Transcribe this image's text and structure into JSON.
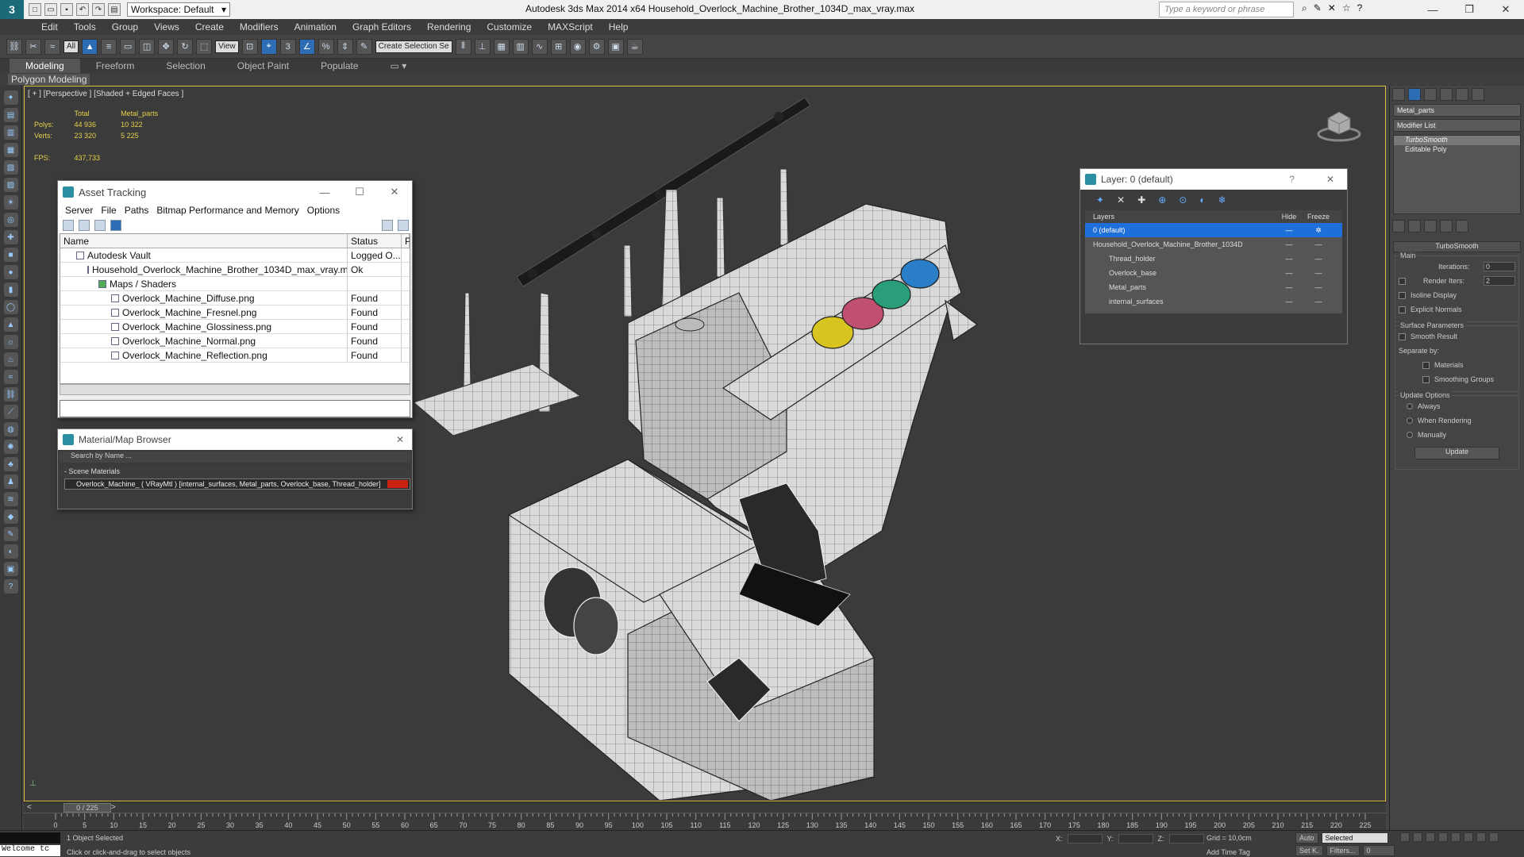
{
  "app": {
    "logo": "3",
    "title": "Autodesk 3ds Max  2014 x64     Household_Overlock_Machine_Brother_1034D_max_vray.max",
    "workspace": "Workspace: Default",
    "search_placeholder": "Type a keyword or phrase"
  },
  "menu": [
    "Edit",
    "Tools",
    "Group",
    "Views",
    "Create",
    "Modifiers",
    "Animation",
    "Graph Editors",
    "Rendering",
    "Customize",
    "MAXScript",
    "Help"
  ],
  "toolbar": {
    "filter": "All",
    "refcoord": "View",
    "selset": "Create Selection Se"
  },
  "ribbon": {
    "tabs": [
      "Modeling",
      "Freeform",
      "Selection",
      "Object Paint",
      "Populate"
    ],
    "active_tab": "Modeling",
    "sub": "Polygon Modeling"
  },
  "viewport": {
    "label": "[ + ] [Perspective ] [Shaded + Edged Faces ]",
    "stats": {
      "h_total": "Total",
      "h_obj": "Metal_parts",
      "polys_label": "Polys:",
      "polys_total": "44 936",
      "polys_obj": "10 322",
      "verts_label": "Verts:",
      "verts_total": "23 320",
      "verts_obj": "5 225",
      "fps_label": "FPS:",
      "fps": "437,733"
    }
  },
  "asset_tracking": {
    "title": "Asset Tracking",
    "menu": [
      "Server",
      "File",
      "Paths",
      "Bitmap Performance and Memory",
      "Options"
    ],
    "col_name": "Name",
    "col_status": "Status",
    "col_p": "P",
    "rows": [
      {
        "name": "Autodesk Vault",
        "status": "Logged O...",
        "indent": 0
      },
      {
        "name": "Household_Overlock_Machine_Brother_1034D_max_vray.max",
        "status": "Ok",
        "indent": 1
      },
      {
        "name": "Maps / Shaders",
        "status": "",
        "indent": 2
      },
      {
        "name": "Overlock_Machine_Diffuse.png",
        "status": "Found",
        "indent": 3
      },
      {
        "name": "Overlock_Machine_Fresnel.png",
        "status": "Found",
        "indent": 3
      },
      {
        "name": "Overlock_Machine_Glossiness.png",
        "status": "Found",
        "indent": 3
      },
      {
        "name": "Overlock_Machine_Normal.png",
        "status": "Found",
        "indent": 3
      },
      {
        "name": "Overlock_Machine_Reflection.png",
        "status": "Found",
        "indent": 3
      }
    ]
  },
  "material_browser": {
    "title": "Material/Map Browser",
    "search": "Search by Name ...",
    "section": "- Scene Materials",
    "item": "Overlock_Machine_  ( VRayMtl ) [internal_surfaces, Metal_parts, Overlock_base, Thread_holder]"
  },
  "layer_dialog": {
    "title": "Layer: 0 (default)",
    "col_layers": "Layers",
    "col_hide": "Hide",
    "col_freeze": "Freeze",
    "rows": [
      {
        "name": "0 (default)",
        "selected": true
      },
      {
        "name": "Household_Overlock_Machine_Brother_1034D",
        "selected": false
      },
      {
        "name": "Thread_holder",
        "selected": false
      },
      {
        "name": "Overlock_base",
        "selected": false
      },
      {
        "name": "Metal_parts",
        "selected": false
      },
      {
        "name": "internal_surfaces",
        "selected": false
      }
    ]
  },
  "command_panel": {
    "object_name": "Metal_parts",
    "modifier_list": "Modifier List",
    "stack": [
      "TurboSmooth",
      "Editable Poly"
    ],
    "rollout": "TurboSmooth",
    "main": "Main",
    "iterations_label": "Iterations:",
    "iterations": "0",
    "render_iters_label": "Render Iters:",
    "render_iters": "2",
    "isoline": "Isoline Display",
    "explicit_normals": "Explicit Normals",
    "surface_params": "Surface Parameters",
    "smooth_result": "Smooth Result",
    "separate_by": "Separate by:",
    "materials": "Materials",
    "smoothing_groups": "Smoothing Groups",
    "update_options": "Update Options",
    "always": "Always",
    "when_rendering": "When Rendering",
    "manually": "Manually",
    "update_btn": "Update"
  },
  "timeline": {
    "frame": "0 / 225",
    "ticks": [
      "0",
      "5",
      "10",
      "15",
      "20",
      "25",
      "30",
      "35",
      "40",
      "45",
      "50",
      "55",
      "60",
      "65",
      "70",
      "75",
      "80",
      "85",
      "90",
      "95",
      "100",
      "105",
      "110",
      "115",
      "120",
      "125",
      "130",
      "135",
      "140",
      "145",
      "150",
      "155",
      "160",
      "165",
      "170",
      "175",
      "180",
      "185",
      "190",
      "195",
      "200",
      "205",
      "210",
      "215",
      "220",
      "225"
    ]
  },
  "status": {
    "welcome": "Welcome tc",
    "selected": "1 Object Selected",
    "hint": "Click or click-and-drag to select objects",
    "x": "X:",
    "y": "Y:",
    "z": "Z:",
    "grid": "Grid = 10,0cm",
    "add_time_tag": "Add Time Tag",
    "auto": "Auto",
    "selected_drop": "Selected",
    "setk": "Set K.",
    "filters": "Filters...",
    "frame": "0"
  },
  "colors": {
    "accent": "#2d6db5",
    "viewport_border": "#e0c040",
    "stats_text": "#e6d04a"
  }
}
